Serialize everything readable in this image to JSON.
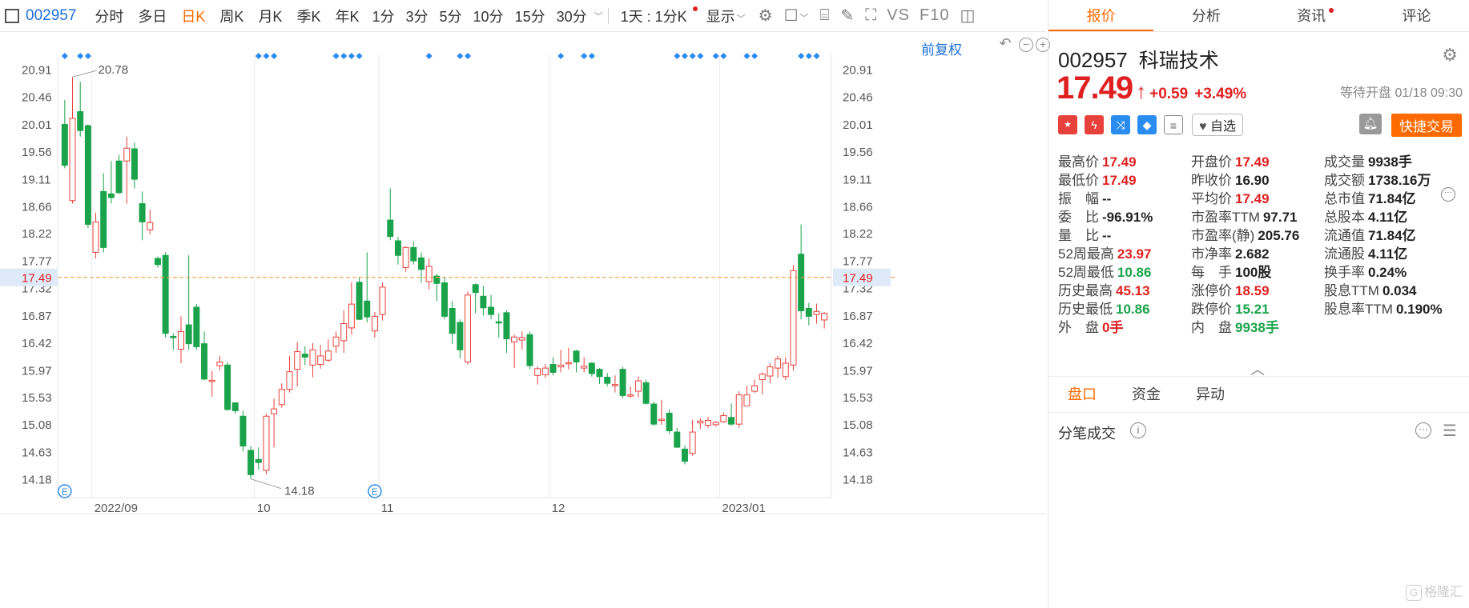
{
  "toolbar": {
    "code": "002957",
    "periods": [
      "分时",
      "多日",
      "日K",
      "周K",
      "月K",
      "季K",
      "年K",
      "1分",
      "3分",
      "5分",
      "10分",
      "15分",
      "30分"
    ],
    "active_period": "日K",
    "range_label": "1天 : 1分K",
    "display_label": "显示",
    "vs_label": "VS",
    "f10_label": "F10"
  },
  "chart": {
    "fuquan_label": "前复权",
    "high_marker": "20.78",
    "low_marker": "14.18",
    "event_badge": "E",
    "current_price_tag": "17.49"
  },
  "chart_data": {
    "type": "candlestick",
    "ylim": [
      13.9,
      21.15
    ],
    "y_ticks": [
      20.91,
      20.46,
      20.01,
      19.56,
      19.11,
      18.66,
      18.22,
      17.77,
      17.32,
      16.87,
      16.42,
      15.97,
      15.53,
      15.08,
      14.63,
      14.18
    ],
    "x_labels": [
      {
        "label": "2022/09",
        "index": 4
      },
      {
        "label": "10",
        "index": 25
      },
      {
        "label": "11",
        "index": 41
      },
      {
        "label": "12",
        "index": 63
      },
      {
        "label": "2023/01",
        "index": 85
      }
    ],
    "current_price": 17.49,
    "candles": [
      [
        20.0,
        19.33,
        20.4,
        19.28
      ],
      [
        18.75,
        20.1,
        20.78,
        18.7
      ],
      [
        20.21,
        19.9,
        20.7,
        19.8
      ],
      [
        19.98,
        18.36,
        20.0,
        18.3
      ],
      [
        17.9,
        18.4,
        18.55,
        17.8
      ],
      [
        18.9,
        17.98,
        19.2,
        17.9
      ],
      [
        18.86,
        18.8,
        19.4,
        18.7
      ],
      [
        19.4,
        18.88,
        19.5,
        18.86
      ],
      [
        19.4,
        19.61,
        19.8,
        18.7
      ],
      [
        19.6,
        19.1,
        19.7,
        18.95
      ],
      [
        18.7,
        18.4,
        18.9,
        18.1
      ],
      [
        18.27,
        18.39,
        18.6,
        18.2
      ],
      [
        17.8,
        17.7,
        17.83,
        17.65
      ],
      [
        17.85,
        16.57,
        17.9,
        16.5
      ],
      [
        16.52,
        16.5,
        16.57,
        16.3
      ],
      [
        16.31,
        16.6,
        16.85,
        16.08
      ],
      [
        16.71,
        16.4,
        17.85,
        16.3
      ],
      [
        17.0,
        16.35,
        17.05,
        16.3
      ],
      [
        16.4,
        15.82,
        16.6,
        15.8
      ],
      [
        15.78,
        15.8,
        15.95,
        15.53
      ],
      [
        16.04,
        16.1,
        16.2,
        15.97
      ],
      [
        16.05,
        15.32,
        16.1,
        15.3
      ],
      [
        15.43,
        15.3,
        15.44,
        15.25
      ],
      [
        15.21,
        14.72,
        15.3,
        14.63
      ],
      [
        14.65,
        14.25,
        14.72,
        14.18
      ],
      [
        14.5,
        14.45,
        14.7,
        14.33
      ],
      [
        14.32,
        15.21,
        15.25,
        14.26
      ],
      [
        15.25,
        15.33,
        15.5,
        14.7
      ],
      [
        15.4,
        15.65,
        15.75,
        15.35
      ],
      [
        15.65,
        15.94,
        16.2,
        15.6
      ],
      [
        15.98,
        16.27,
        16.43,
        15.7
      ],
      [
        16.23,
        16.18,
        16.36,
        16.05
      ],
      [
        16.05,
        16.3,
        16.41,
        15.85
      ],
      [
        16.06,
        16.2,
        16.38,
        15.99
      ],
      [
        16.13,
        16.28,
        16.47,
        16.1
      ],
      [
        16.36,
        16.51,
        16.6,
        16.25
      ],
      [
        16.45,
        16.73,
        16.95,
        16.25
      ],
      [
        16.66,
        17.05,
        17.41,
        16.55
      ],
      [
        17.41,
        16.8,
        17.5,
        16.79
      ],
      [
        17.1,
        16.84,
        17.9,
        16.75
      ],
      [
        16.61,
        16.85,
        16.92,
        16.5
      ],
      [
        16.88,
        17.33,
        17.4,
        16.78
      ],
      [
        18.43,
        18.16,
        18.95,
        18.1
      ],
      [
        18.09,
        17.85,
        18.15,
        17.7
      ],
      [
        17.65,
        17.98,
        18.0,
        17.58
      ],
      [
        17.98,
        17.76,
        18.08,
        17.7
      ],
      [
        17.81,
        17.62,
        17.9,
        17.4
      ],
      [
        17.42,
        17.67,
        17.8,
        17.29
      ],
      [
        17.51,
        17.39,
        17.55,
        17.1
      ],
      [
        17.4,
        16.85,
        17.5,
        16.8
      ],
      [
        16.98,
        16.57,
        17.1,
        16.4
      ],
      [
        16.75,
        16.3,
        16.8,
        16.16
      ],
      [
        16.1,
        17.2,
        17.26,
        16.06
      ],
      [
        17.37,
        17.24,
        17.39,
        16.9
      ],
      [
        17.18,
        16.99,
        17.35,
        16.86
      ],
      [
        17.0,
        16.88,
        17.2,
        16.8
      ],
      [
        16.76,
        16.74,
        16.9,
        16.5
      ],
      [
        16.91,
        16.48,
        16.95,
        16.25
      ],
      [
        16.43,
        16.51,
        16.55,
        16.0
      ],
      [
        16.46,
        16.5,
        16.6,
        16.3
      ],
      [
        16.55,
        16.04,
        16.6,
        15.98
      ],
      [
        15.88,
        15.99,
        16.03,
        15.73
      ],
      [
        15.89,
        16.0,
        16.07,
        15.84
      ],
      [
        16.06,
        15.93,
        16.18,
        15.88
      ],
      [
        16.02,
        16.05,
        16.3,
        15.93
      ],
      [
        16.09,
        16.09,
        16.33,
        15.98
      ],
      [
        16.28,
        16.1,
        16.3,
        15.93
      ],
      [
        16.0,
        16.03,
        16.18,
        15.93
      ],
      [
        16.08,
        15.91,
        16.1,
        15.86
      ],
      [
        15.98,
        15.86,
        16.0,
        15.74
      ],
      [
        15.85,
        15.75,
        15.92,
        15.7
      ],
      [
        15.73,
        15.73,
        15.88,
        15.6
      ],
      [
        15.98,
        15.55,
        16.02,
        15.51
      ],
      [
        15.56,
        15.56,
        15.7,
        15.51
      ],
      [
        15.62,
        15.79,
        15.86,
        15.52
      ],
      [
        15.76,
        15.42,
        15.81,
        15.4
      ],
      [
        15.41,
        15.08,
        15.45,
        15.05
      ],
      [
        15.15,
        15.16,
        15.48,
        15.07
      ],
      [
        15.26,
        14.97,
        15.32,
        14.92
      ],
      [
        14.95,
        14.7,
        15.02,
        14.7
      ],
      [
        14.67,
        14.47,
        14.73,
        14.42
      ],
      [
        14.6,
        14.95,
        15.15,
        14.56
      ],
      [
        15.1,
        15.13,
        15.18,
        15.0
      ],
      [
        15.06,
        15.14,
        15.2,
        15.02
      ],
      [
        15.07,
        15.11,
        15.13,
        15.04
      ],
      [
        15.12,
        15.22,
        15.27,
        15.1
      ],
      [
        15.19,
        15.08,
        15.42,
        15.05
      ],
      [
        15.08,
        15.56,
        15.62,
        15.02
      ],
      [
        15.38,
        15.56,
        15.71,
        15.38
      ],
      [
        15.62,
        15.71,
        15.81,
        15.59
      ],
      [
        15.81,
        15.9,
        15.93,
        15.57
      ],
      [
        15.87,
        16.02,
        16.08,
        15.75
      ],
      [
        16.0,
        16.15,
        16.2,
        15.84
      ],
      [
        15.86,
        16.08,
        16.18,
        15.8
      ],
      [
        16.05,
        17.6,
        17.69,
        15.96
      ],
      [
        17.87,
        16.94,
        18.36,
        16.8
      ],
      [
        16.98,
        16.85,
        17.07,
        16.7
      ],
      [
        16.88,
        16.93,
        17.06,
        16.73
      ],
      [
        16.79,
        16.9,
        16.92,
        16.65
      ]
    ]
  },
  "panel": {
    "tabs": [
      "报价",
      "分析",
      "资讯",
      "评论"
    ],
    "code": "002957",
    "name": "科瑞技术",
    "price": "17.49",
    "change": "+0.59",
    "change_pct": "+3.49%",
    "status": "等待开盘 01/18 09:30",
    "watch_label": "自选",
    "quick_trade": "快捷交易",
    "stats": [
      [
        {
          "label": "最高价",
          "value": "17.49",
          "tone": "up"
        },
        {
          "label": "开盘价",
          "value": "17.49",
          "tone": "up"
        },
        {
          "label": "成交量",
          "value": "9938手",
          "tone": "nt"
        }
      ],
      [
        {
          "label": "最低价",
          "value": "17.49",
          "tone": "up"
        },
        {
          "label": "昨收价",
          "value": "16.90",
          "tone": "nt"
        },
        {
          "label": "成交额",
          "value": "1738.16万",
          "tone": "nt"
        }
      ],
      [
        {
          "label": "振　幅",
          "value": "--",
          "tone": "nt"
        },
        {
          "label": "平均价",
          "value": "17.49",
          "tone": "up"
        },
        {
          "label": "总市值",
          "value": "71.84亿",
          "tone": "nt"
        }
      ],
      [
        {
          "label": "委　比",
          "value": "-96.91%",
          "tone": "nt"
        },
        {
          "label": "市盈率TTM",
          "value": "97.71",
          "tone": "nt"
        },
        {
          "label": "总股本",
          "value": "4.11亿",
          "tone": "nt"
        }
      ],
      [
        {
          "label": "量　比",
          "value": "--",
          "tone": "nt"
        },
        {
          "label": "市盈率(静)",
          "value": "205.76",
          "tone": "nt"
        },
        {
          "label": "流通值",
          "value": "71.84亿",
          "tone": "nt"
        }
      ],
      [
        {
          "label": "52周最高",
          "value": "23.97",
          "tone": "up"
        },
        {
          "label": "市净率",
          "value": "2.682",
          "tone": "nt"
        },
        {
          "label": "流通股",
          "value": "4.11亿",
          "tone": "nt"
        }
      ],
      [
        {
          "label": "52周最低",
          "value": "10.86",
          "tone": "down"
        },
        {
          "label": "每　手",
          "value": "100股",
          "tone": "nt"
        },
        {
          "label": "换手率",
          "value": "0.24%",
          "tone": "nt"
        }
      ],
      [
        {
          "label": "历史最高",
          "value": "45.13",
          "tone": "up"
        },
        {
          "label": "涨停价",
          "value": "18.59",
          "tone": "up"
        },
        {
          "label": "股息TTM",
          "value": "0.034",
          "tone": "nt"
        }
      ],
      [
        {
          "label": "历史最低",
          "value": "10.86",
          "tone": "down"
        },
        {
          "label": "跌停价",
          "value": "15.21",
          "tone": "down"
        },
        {
          "label": "股息率TTM",
          "value": "0.190%",
          "tone": "nt"
        }
      ],
      [
        {
          "label": "外　盘",
          "value": "0手",
          "tone": "up"
        },
        {
          "label": "内　盘",
          "value": "9938手",
          "tone": "down"
        }
      ]
    ],
    "subtabs": [
      "盘口",
      "资金",
      "异动"
    ],
    "tick_title": "分笔成交",
    "watermark": "格隆汇"
  }
}
